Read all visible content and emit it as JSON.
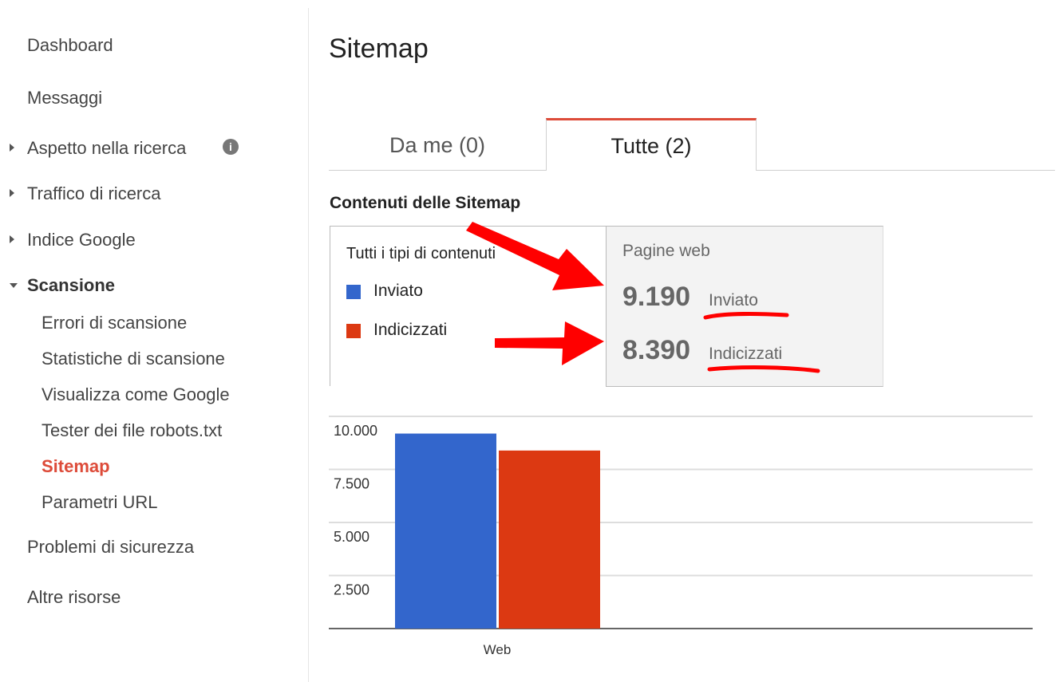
{
  "sidebar": {
    "items": [
      {
        "label": "Dashboard"
      },
      {
        "label": "Messaggi"
      },
      {
        "label": "Aspetto nella ricerca"
      },
      {
        "label": "Traffico di ricerca"
      },
      {
        "label": "Indice Google"
      },
      {
        "label": "Scansione"
      },
      {
        "label": "Errori di scansione"
      },
      {
        "label": "Statistiche di scansione"
      },
      {
        "label": "Visualizza come Google"
      },
      {
        "label": "Tester dei file robots.txt"
      },
      {
        "label": "Sitemap"
      },
      {
        "label": "Parametri URL"
      },
      {
        "label": "Problemi di sicurezza"
      },
      {
        "label": "Altre risorse"
      }
    ],
    "info_icon_glyph": "i"
  },
  "main": {
    "title": "Sitemap",
    "tabs": [
      {
        "label": "Da me (0)"
      },
      {
        "label": "Tutte (2)"
      }
    ],
    "section_heading": "Contenuti delle Sitemap",
    "legend": {
      "title": "Tutti i tipi di contenuti",
      "items": [
        {
          "label": "Inviato",
          "color": "#3366cc"
        },
        {
          "label": "Indicizzati",
          "color": "#dc3912"
        }
      ]
    },
    "stats": {
      "title": "Pagine web",
      "submitted_value": "9.190",
      "submitted_label": "Inviato",
      "indexed_value": "8.390",
      "indexed_label": "Indicizzati"
    }
  },
  "colors": {
    "accent": "#dd4b39",
    "submitted": "#3366cc",
    "indexed": "#dc3912",
    "annotation": "#ff0000"
  },
  "chart_data": {
    "type": "bar",
    "categories": [
      "Web"
    ],
    "series": [
      {
        "name": "Inviato",
        "values": [
          9190
        ]
      },
      {
        "name": "Indicizzati",
        "values": [
          8390
        ]
      }
    ],
    "ylim": [
      0,
      10000
    ],
    "yticks": [
      2500,
      5000,
      7500,
      10000
    ],
    "ytick_labels": [
      "2.500",
      "5.000",
      "7.500",
      "10.000"
    ],
    "grid": true
  }
}
